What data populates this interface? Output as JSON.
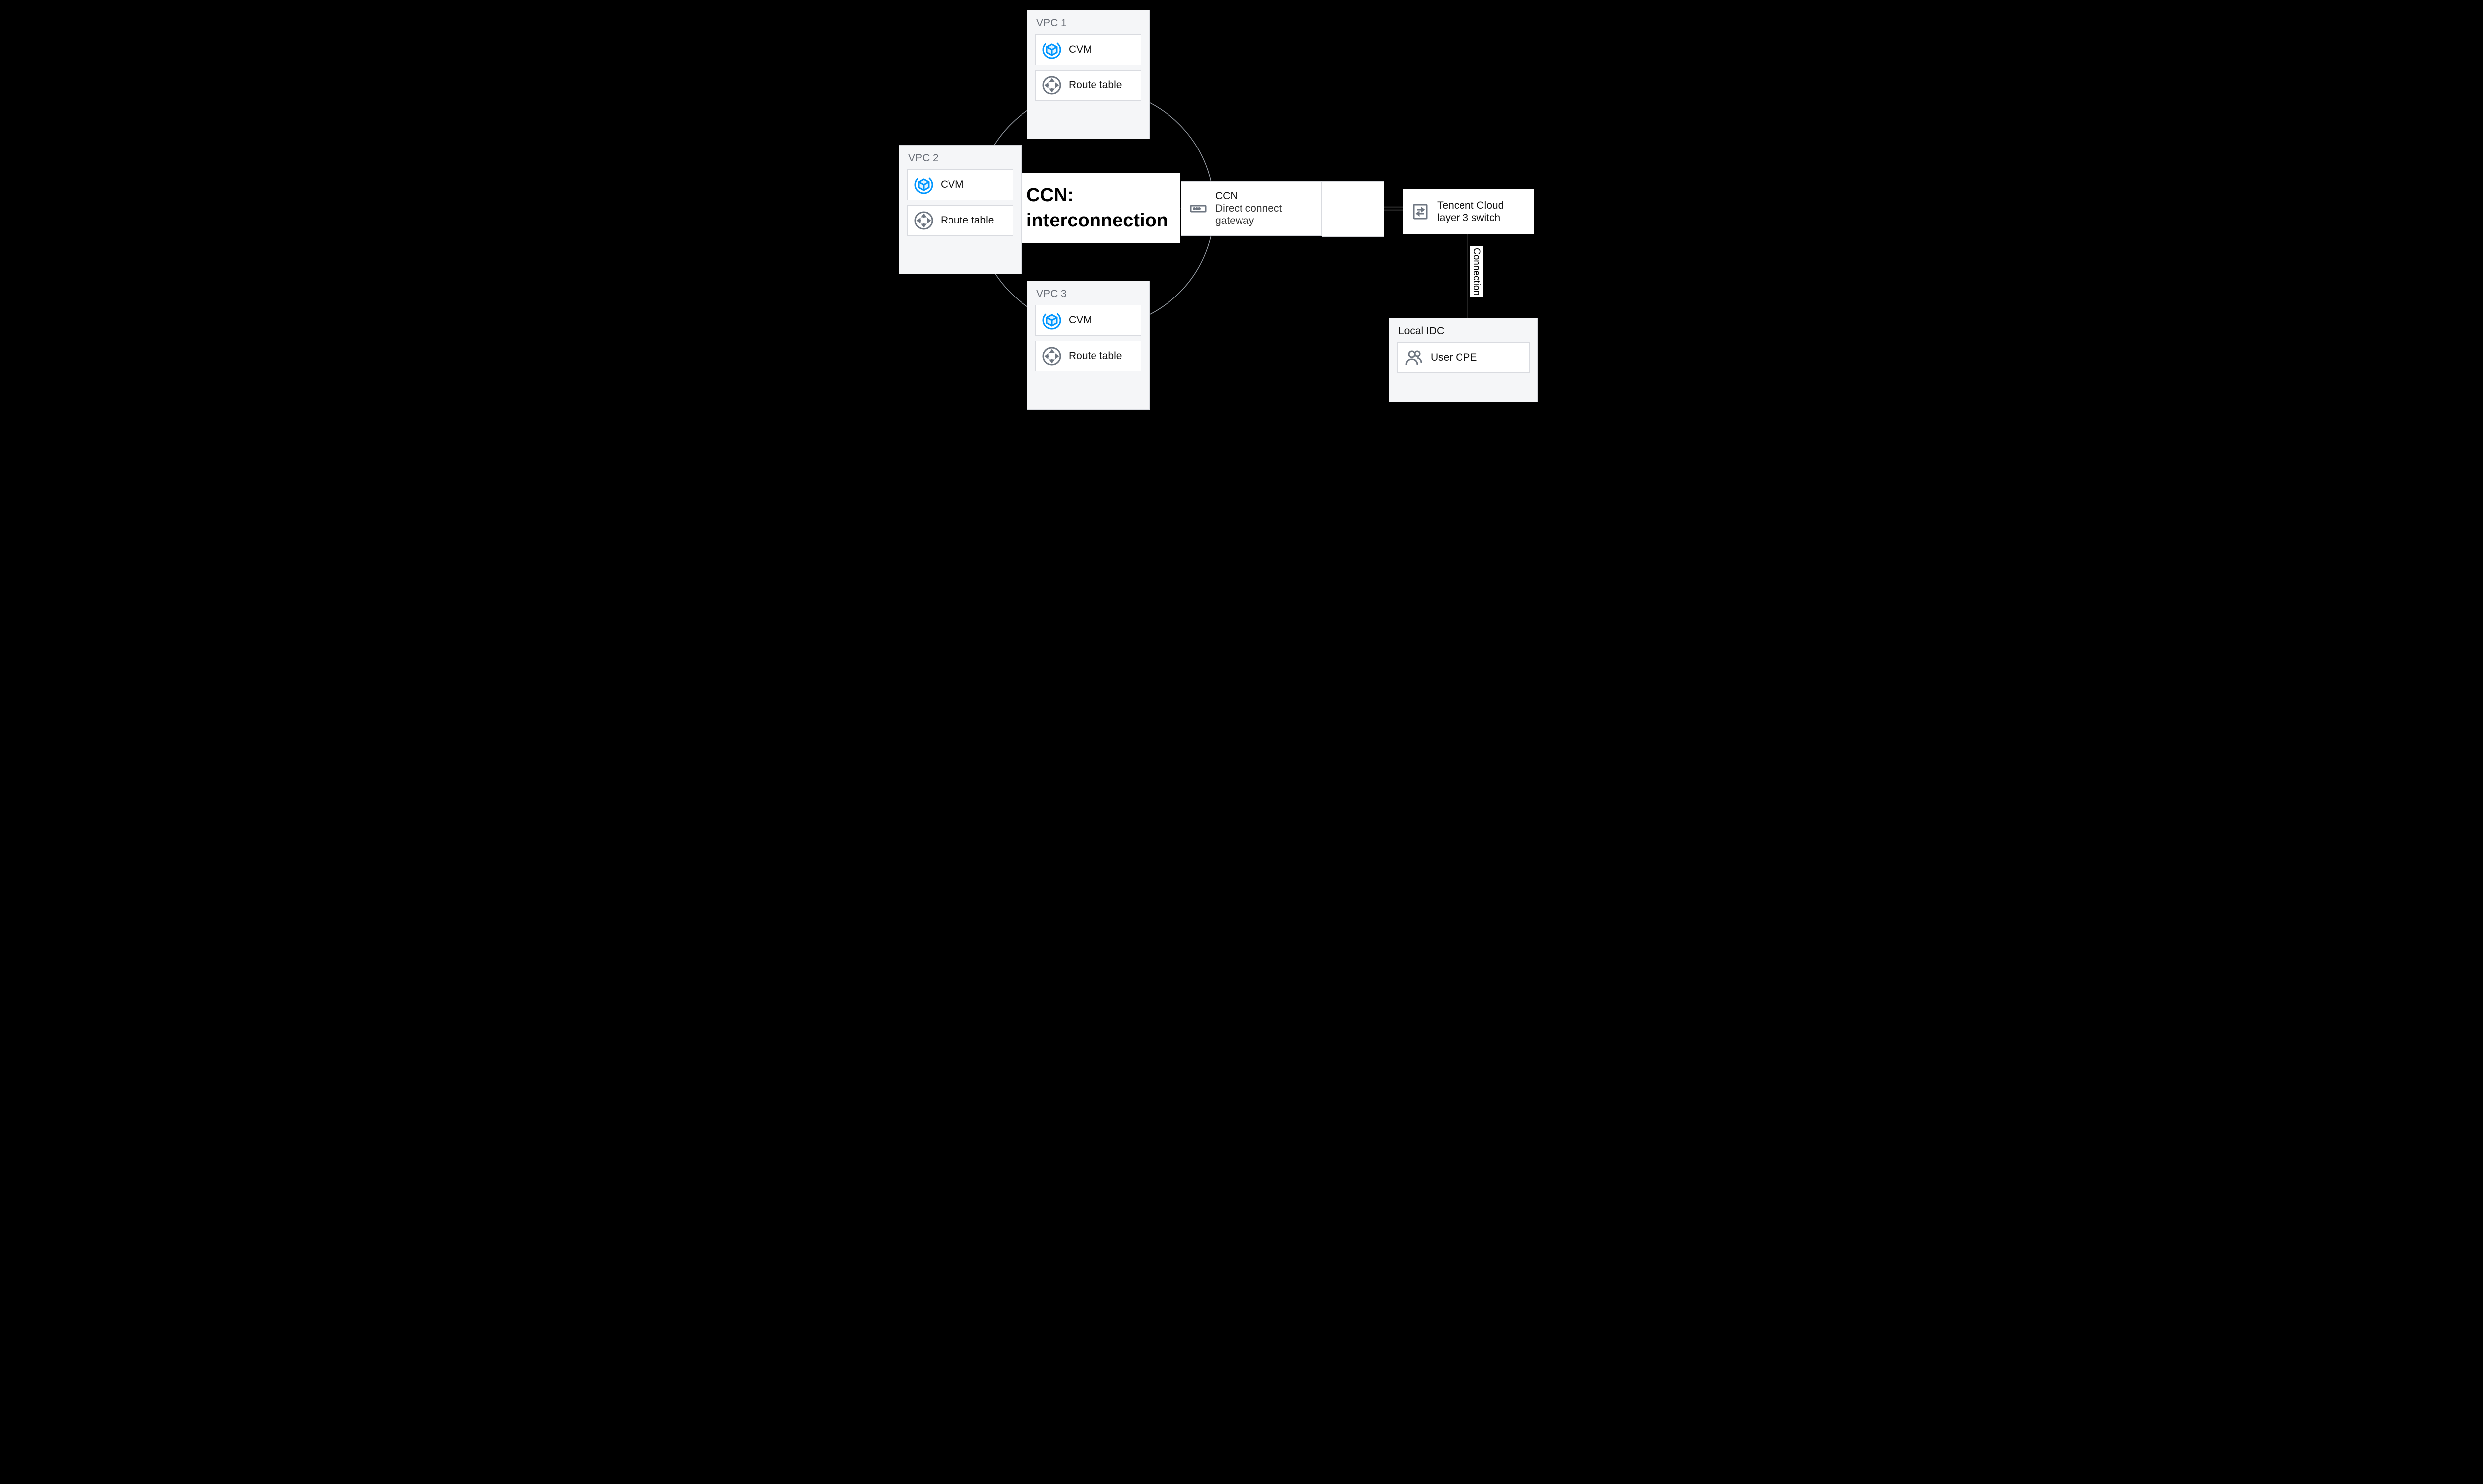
{
  "vpcPanels": [
    {
      "id": "vpc1",
      "title": "VPC 1",
      "cvm": "CVM",
      "route": "Route table"
    },
    {
      "id": "vpc2",
      "title": "VPC 2",
      "cvm": "CVM",
      "route": "Route table"
    },
    {
      "id": "vpc3",
      "title": "VPC 3",
      "cvm": "CVM",
      "route": "Route table"
    }
  ],
  "ccnLabel": "CCN:\ninterconnection",
  "gateway": {
    "title": "CCN",
    "sub": "Direct connect\ngateway"
  },
  "switch": "Tencent Cloud\nlayer 3 switch",
  "connection": "Connection",
  "idc": {
    "title": "Local IDC",
    "item": "User CPE"
  },
  "hints": {
    "top": "",
    "bottom": ""
  }
}
